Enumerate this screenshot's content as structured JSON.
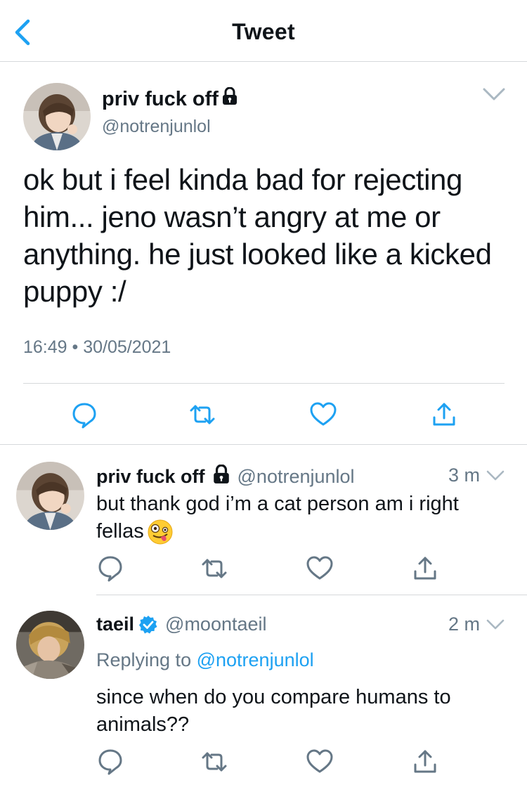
{
  "header": {
    "title": "Tweet"
  },
  "main_tweet": {
    "name": "priv fuck off",
    "handle": "@notrenjunlol",
    "text": "ok but i feel kinda bad for rejecting him... jeno wasn’t angry at me or anything. he just looked like a kicked puppy :/",
    "timestamp": "16:49 • 30/05/2021"
  },
  "replies": [
    {
      "name": "priv fuck off",
      "handle": "@notrenjunlol",
      "time": "3 m",
      "text": "but thank god i’m a cat person am i right fellas",
      "emoji": "zany-face"
    },
    {
      "name": "taeil",
      "handle": "@moontaeil",
      "time": "2 m",
      "verified": true,
      "replying_prefix": "Replying to",
      "replying_to": "@notrenjunlol",
      "text": "since when do you compare humans to animals??"
    }
  ],
  "icons": {
    "back": "chevron-left-icon",
    "more": "chevron-down-icon",
    "lock": "lock-icon",
    "reply": "reply-icon",
    "retweet": "retweet-icon",
    "like": "heart-icon",
    "share": "share-icon",
    "verified": "verified-badge-icon"
  },
  "colors": {
    "accent": "#1da1f2",
    "text": "#0f1419",
    "secondary": "#657786",
    "divider": "#d6d9db"
  }
}
